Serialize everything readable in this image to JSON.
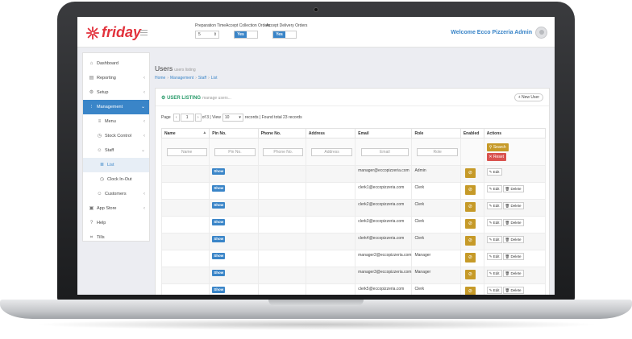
{
  "brand": {
    "name": "friday",
    "color": "#e2323c"
  },
  "topbar": {
    "preparation_time_label": "Preparation Time",
    "preparation_time_value": "5",
    "accept_collection_label": "Accept Collection Orders",
    "accept_collection_value": "Yes",
    "accept_delivery_label": "Accept Delivery Orders",
    "accept_delivery_value": "Yes",
    "welcome": "Welcome Ecco Pizzeria Admin"
  },
  "sidebar": {
    "items": [
      {
        "label": "Dashboard",
        "icon": "home-icon"
      },
      {
        "label": "Reporting",
        "icon": "chart-icon"
      },
      {
        "label": "Setup",
        "icon": "gear-icon"
      },
      {
        "label": "Management",
        "icon": "sliders-icon"
      },
      {
        "label": "Menu",
        "icon": "menu-icon"
      },
      {
        "label": "Stock Control",
        "icon": "clock-icon"
      },
      {
        "label": "Staff",
        "icon": "user-icon"
      },
      {
        "label": "List",
        "icon": "list-icon"
      },
      {
        "label": "Clock In-Out",
        "icon": "clock-icon"
      },
      {
        "label": "Customers",
        "icon": "user-icon"
      },
      {
        "label": "App Store",
        "icon": "box-icon"
      },
      {
        "label": "Help",
        "icon": "help-icon"
      },
      {
        "label": "Tills",
        "icon": "tills-icon"
      }
    ]
  },
  "page": {
    "title": "Users",
    "subtitle": "users listing",
    "breadcrumb": [
      "Home",
      "Management",
      "Staff",
      "List"
    ]
  },
  "listing": {
    "title": "USER LISTING",
    "subtitle": "manage users...",
    "new_user": "+ New User",
    "pager": {
      "page_label": "Page",
      "prev": "‹",
      "page": "1",
      "next": "›",
      "of_view": "of 3 | View",
      "per_page": "10",
      "summary": "records | Found total 23 records"
    },
    "columns": [
      "Name",
      "Pin No.",
      "Phone No.",
      "Address",
      "Email",
      "Role",
      "Enabled",
      "Actions"
    ],
    "filters": {
      "name": "Name",
      "pin": "Pin No.",
      "phone": "Phone No.",
      "address": "Address",
      "email": "Email",
      "role": "Role",
      "search": "Search",
      "reset": "Reset"
    },
    "show_label": "Show",
    "edit_label": "Edit",
    "delete_label": "Delete",
    "enabled_glyph": "⊘",
    "rows": [
      {
        "email": "manager@eccopizzeria.com",
        "role": "Admin"
      },
      {
        "email": "clerk1@eccopizzeria.com",
        "role": "Clerk"
      },
      {
        "email": "clerk2@eccopizzeria.com",
        "role": "Clerk"
      },
      {
        "email": "clerk3@eccopizzeria.com",
        "role": "Clerk"
      },
      {
        "email": "clerk4@eccopizzeria.com",
        "role": "Clerk"
      },
      {
        "email": "manager2@eccopizzeria.com",
        "role": "Manager"
      },
      {
        "email": "manager3@eccopizzeria.com",
        "role": "Manager"
      },
      {
        "email": "clerk5@eccopizzeria.com",
        "role": "Clerk"
      }
    ]
  },
  "colors": {
    "accent": "#3a85c8",
    "gold": "#c69a28",
    "danger": "#d9534f",
    "green": "#2a9b6b"
  }
}
